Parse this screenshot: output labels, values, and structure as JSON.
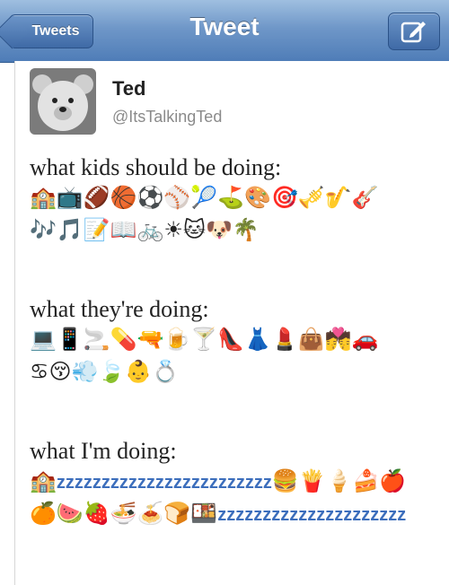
{
  "navbar": {
    "back_label": "Tweets",
    "title": "Tweet",
    "compose_icon": "compose-icon"
  },
  "tweet": {
    "author_name": "Ted",
    "author_handle": "@ItsTalkingTed",
    "section1_heading": "what kids should be doing:",
    "section1_emoji_row1": "🏫📺🏈🏀⚽⚾🎾⛳🎨🎯🎺🎷🎸",
    "section1_emoji_row2": "🎶🎵📝📖🚲☀🐱🐶🌴",
    "section2_heading": "what they're doing:",
    "section2_emoji_row1": "💻📱🚬💊🔫🍺🍸👠👗💄👜💏🚗",
    "section2_emoji_row2": "♋😚💨🍃👶💍",
    "section3_heading": "what I'm doing:",
    "section3_emoji_row1_start": "🏫",
    "section3_zzz_row1": "zzzzzzzzzzzzzzzzzzzzzzzz",
    "section3_emoji_row1_end": "🍔🍟🍦🍰🍎",
    "section3_emoji_row2_start": "🍊🍉🍓🍜🍝🍞🍱",
    "section3_zzz_row2": "zzzzzzzzzzzzzzzzzzzzz"
  },
  "colors": {
    "nav_blue": "#4e7cb7",
    "zzz_blue": "#3c6ebc"
  }
}
